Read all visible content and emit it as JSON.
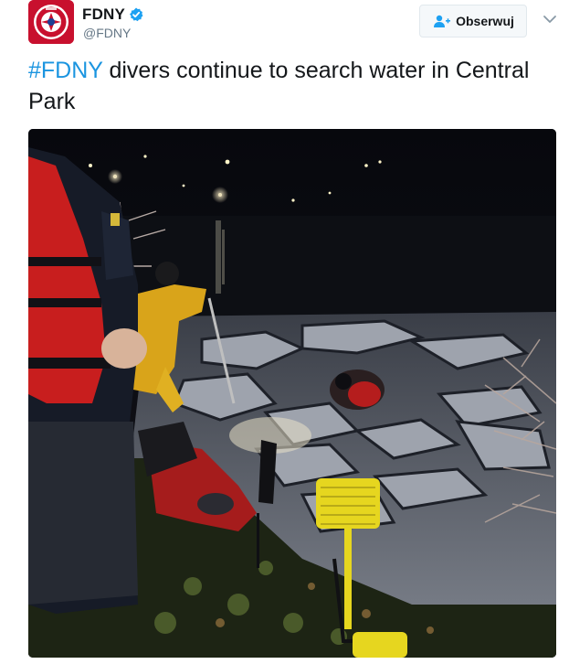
{
  "account": {
    "display_name": "FDNY",
    "handle": "@FDNY",
    "verified": true,
    "avatar_icon": "fdny-logo-icon",
    "verified_icon": "verified-badge-icon"
  },
  "follow": {
    "label": "Obserwuj",
    "icon": "add-user-icon"
  },
  "menu": {
    "icon": "chevron-down-icon"
  },
  "tweet": {
    "hashtag": "#FDNY",
    "text": " divers continue to search water in Central Park"
  },
  "photo": {
    "description_icon": "tweet-photo"
  },
  "colors": {
    "link": "#1b95e0",
    "text": "#14171a",
    "muted": "#657786",
    "button_bg": "#f5f8fa",
    "button_border": "#e1e8ed",
    "fdny_red": "#c8102e"
  }
}
